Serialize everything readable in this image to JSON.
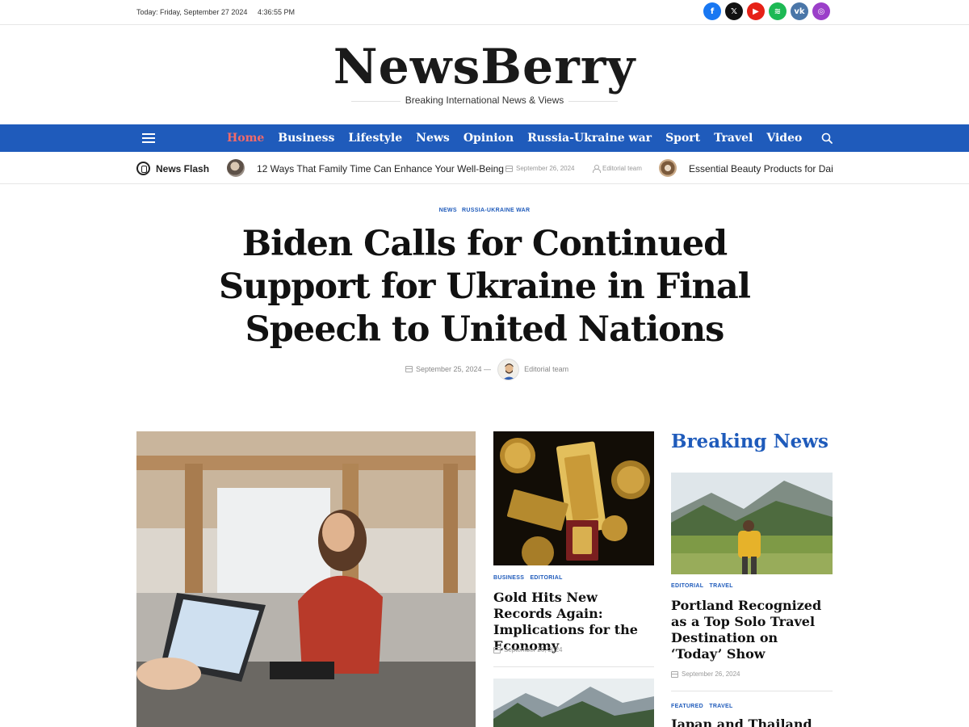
{
  "topbar": {
    "date": "Today: Friday, September 27 2024",
    "time": "4:36:55 PM",
    "socials": [
      {
        "icon": "facebook-icon",
        "glyph": "f",
        "color": "#1877f2"
      },
      {
        "icon": "x-icon",
        "glyph": "𝕏",
        "color": "#111111"
      },
      {
        "icon": "youtube-icon",
        "glyph": "▶",
        "color": "#e62117"
      },
      {
        "icon": "spotify-icon",
        "glyph": "≋",
        "color": "#1db954"
      },
      {
        "icon": "vk-icon",
        "glyph": "vk",
        "color": "#4a76a8"
      },
      {
        "icon": "instagram-icon",
        "glyph": "◎",
        "color": "#9b3fc9"
      }
    ]
  },
  "brand": {
    "logo": "NewsBerry",
    "tagline": "Breaking International News & Views"
  },
  "nav": {
    "items": [
      "Home",
      "Business",
      "Lifestyle",
      "News",
      "Opinion",
      "Russia-Ukraine war",
      "Sport",
      "Travel",
      "Video"
    ],
    "active_index": 0,
    "accent": "#1f5bbb",
    "active_color": "#f26a6a"
  },
  "flash": {
    "label": "News Flash",
    "items": [
      {
        "title": "12 Ways That Family Time Can Enhance Your Well-Being",
        "date": "September 26, 2024",
        "author": "Editorial team"
      },
      {
        "title": "Essential Beauty Products for Daily"
      }
    ]
  },
  "hero": {
    "categories": [
      "NEWS",
      "RUSSIA-UKRAINE WAR"
    ],
    "title": "Biden Calls for Continued Support for Ukraine in Final Speech to United Nations",
    "date": "September 25, 2024 —",
    "author": "Editorial team"
  },
  "cards": {
    "gold": {
      "categories": [
        "BUSINESS",
        "EDITORIAL"
      ],
      "title": "Gold Hits New Records Again: Implications for the Economy",
      "date": "September 26, 2024"
    }
  },
  "breaking": {
    "heading": "Breaking News",
    "items": [
      {
        "categories": [
          "EDITORIAL",
          "TRAVEL"
        ],
        "title": "Portland Recognized as a Top Solo Travel Destination on ‘Today’ Show",
        "date": "September 26, 2024"
      },
      {
        "categories": [
          "FEATURED",
          "TRAVEL"
        ],
        "title": "Japan and Thailand are the"
      }
    ]
  }
}
